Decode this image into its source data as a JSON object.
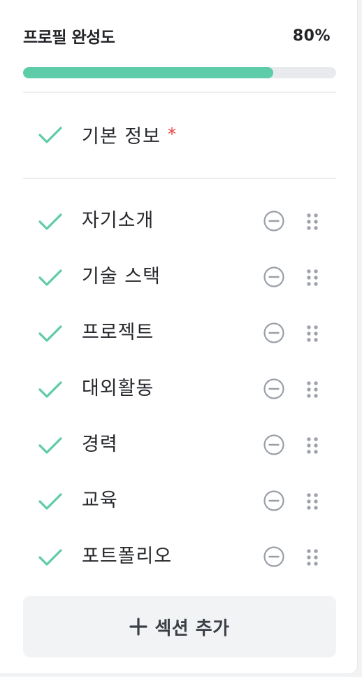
{
  "profile": {
    "title": "프로필 완성도",
    "percent_label": "80%",
    "progress_fraction": 0.8,
    "accent_color": "#5ecba9"
  },
  "basic_section": {
    "label": "기본 정보",
    "required_mark": "*",
    "icon": "check-icon"
  },
  "sections": [
    {
      "label": "자기소개",
      "icon": "check-icon"
    },
    {
      "label": "기술 스택",
      "icon": "check-icon"
    },
    {
      "label": "프로젝트",
      "icon": "check-icon"
    },
    {
      "label": "대외활동",
      "icon": "check-icon"
    },
    {
      "label": "경력",
      "icon": "check-icon"
    },
    {
      "label": "교육",
      "icon": "check-icon"
    },
    {
      "label": "포트폴리오",
      "icon": "check-icon"
    }
  ],
  "add_section": {
    "label": "섹션 추가",
    "icon": "plus-icon"
  },
  "row_icons": {
    "remove": "minus-circle-icon",
    "drag": "drag-handle-icon"
  }
}
